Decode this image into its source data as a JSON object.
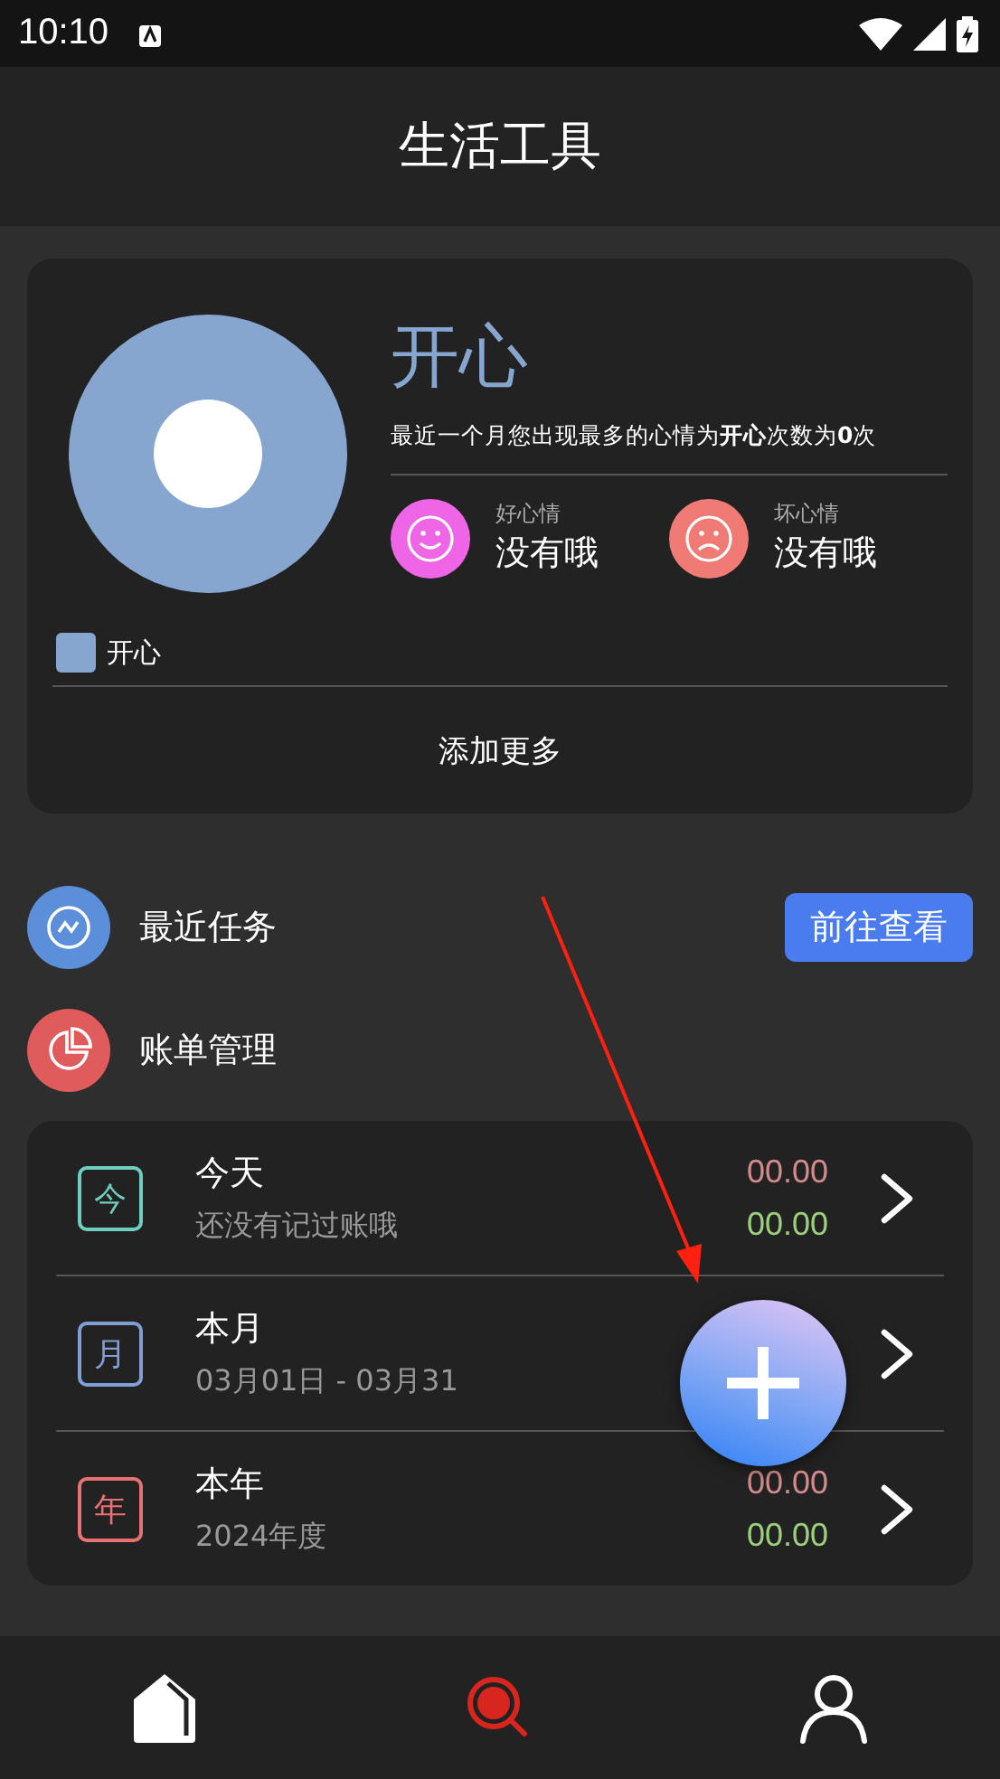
{
  "status_bar": {
    "time": "10:10"
  },
  "header": {
    "title": "生活工具"
  },
  "mood_card": {
    "legend": [
      {
        "label": "开心",
        "color": "#86a6cf"
      }
    ],
    "headline": "开心",
    "summary": "最近一个月您出现最多的心情为**开心**次数为**0**次",
    "moods": [
      {
        "kind": "good",
        "label": "好心情",
        "value": "没有哦"
      },
      {
        "kind": "bad",
        "label": "坏心情",
        "value": "没有哦"
      }
    ],
    "action": "添加更多"
  },
  "shortcuts": [
    {
      "kind": "tasks",
      "label": "最近任务",
      "button": "前往查看"
    },
    {
      "kind": "bills",
      "label": "账单管理"
    }
  ],
  "bill_rows": [
    {
      "badge": "今",
      "color": "#6fcfbf",
      "title": "今天",
      "subtitle": "还没有记过账哦",
      "expense": "00.00",
      "income": "00.00"
    },
    {
      "badge": "月",
      "color": "#7f9fd6",
      "title": "本月",
      "subtitle": "03月01日  -  03月31"
    },
    {
      "badge": "年",
      "color": "#e87272",
      "title": "本年",
      "subtitle": "2024年度",
      "expense": "00.00",
      "income": "00.00"
    }
  ],
  "bottom_nav": [
    {
      "kind": "home",
      "selected": false
    },
    {
      "kind": "search",
      "selected": true
    },
    {
      "kind": "profile",
      "selected": false
    }
  ]
}
